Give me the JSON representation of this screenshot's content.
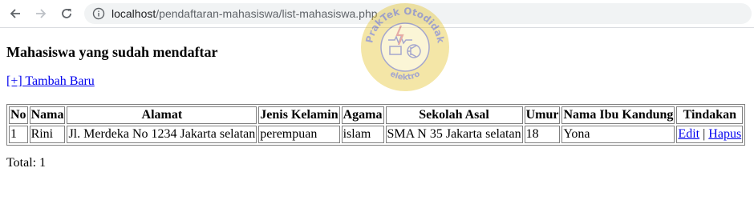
{
  "browser": {
    "url_host": "localhost",
    "url_path": "/pendaftaran-mahasiswa/list-mahasiswa.php",
    "icons": [
      "back-arrow-icon",
      "forward-arrow-icon",
      "reload-icon",
      "info-icon"
    ]
  },
  "watermark": {
    "text_top": "PrakTek Otodidak",
    "text_bottom": "elektro",
    "colors": {
      "ring": "#e5c530",
      "text": "#2a2f8c"
    }
  },
  "page": {
    "title": "Mahasiswa yang sudah mendaftar",
    "add_link": "[+] Tambah Baru",
    "table": {
      "headers": [
        "No",
        "Nama",
        "Alamat",
        "Jenis Kelamin",
        "Agama",
        "Sekolah Asal",
        "Umur",
        "Nama Ibu Kandung",
        "Tindakan"
      ],
      "rows": [
        {
          "no": "1",
          "nama": "Rini",
          "alamat": "Jl. Merdeka No 1234 Jakarta selatan",
          "jenis_kelamin": "perempuan",
          "agama": "islam",
          "sekolah_asal": "SMA N 35 Jakarta selatan",
          "umur": "18",
          "nama_ibu": "Yona",
          "edit": "Edit",
          "separator": "|",
          "hapus": "Hapus"
        }
      ]
    },
    "total": "Total: 1"
  },
  "colors": {
    "link": "#0000ee",
    "table_border": "#808080",
    "address_bar_bg": "#f1f3f4"
  }
}
